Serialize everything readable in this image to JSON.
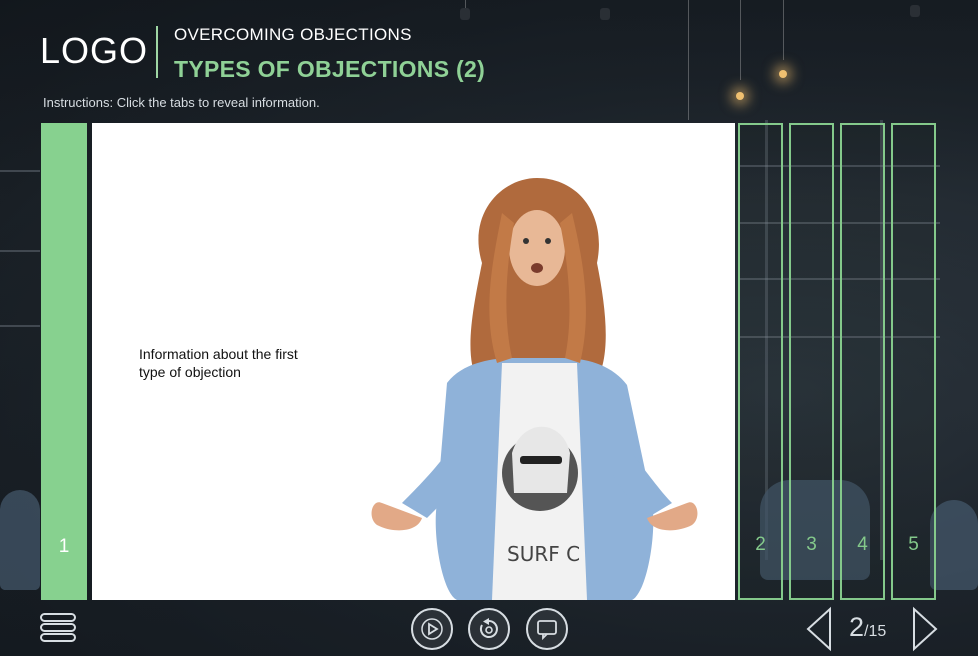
{
  "header": {
    "logo": "LOGO",
    "course_title": "OVERCOMING OBJECTIONS",
    "slide_title": "TYPES OF OBJECTIONS (2)",
    "instructions": "Instructions: Click the tabs to reveal information."
  },
  "tabs": [
    {
      "number": "1",
      "active": true
    },
    {
      "number": "2",
      "active": false
    },
    {
      "number": "3",
      "active": false
    },
    {
      "number": "4",
      "active": false
    },
    {
      "number": "5",
      "active": false
    }
  ],
  "panel": {
    "text": "Information about the first type of objection",
    "image": "man-with-long-hair-shrugging"
  },
  "controls": {
    "menu_icon": "menu-stack-icon",
    "play_icon": "play-icon",
    "replay_icon": "replay-icon",
    "captions_icon": "captions-icon"
  },
  "pagination": {
    "current": "2",
    "total": "/15"
  },
  "colors": {
    "accent": "#87d18f",
    "tab_outline": "#84c98b",
    "text_light": "#d7dde2"
  }
}
